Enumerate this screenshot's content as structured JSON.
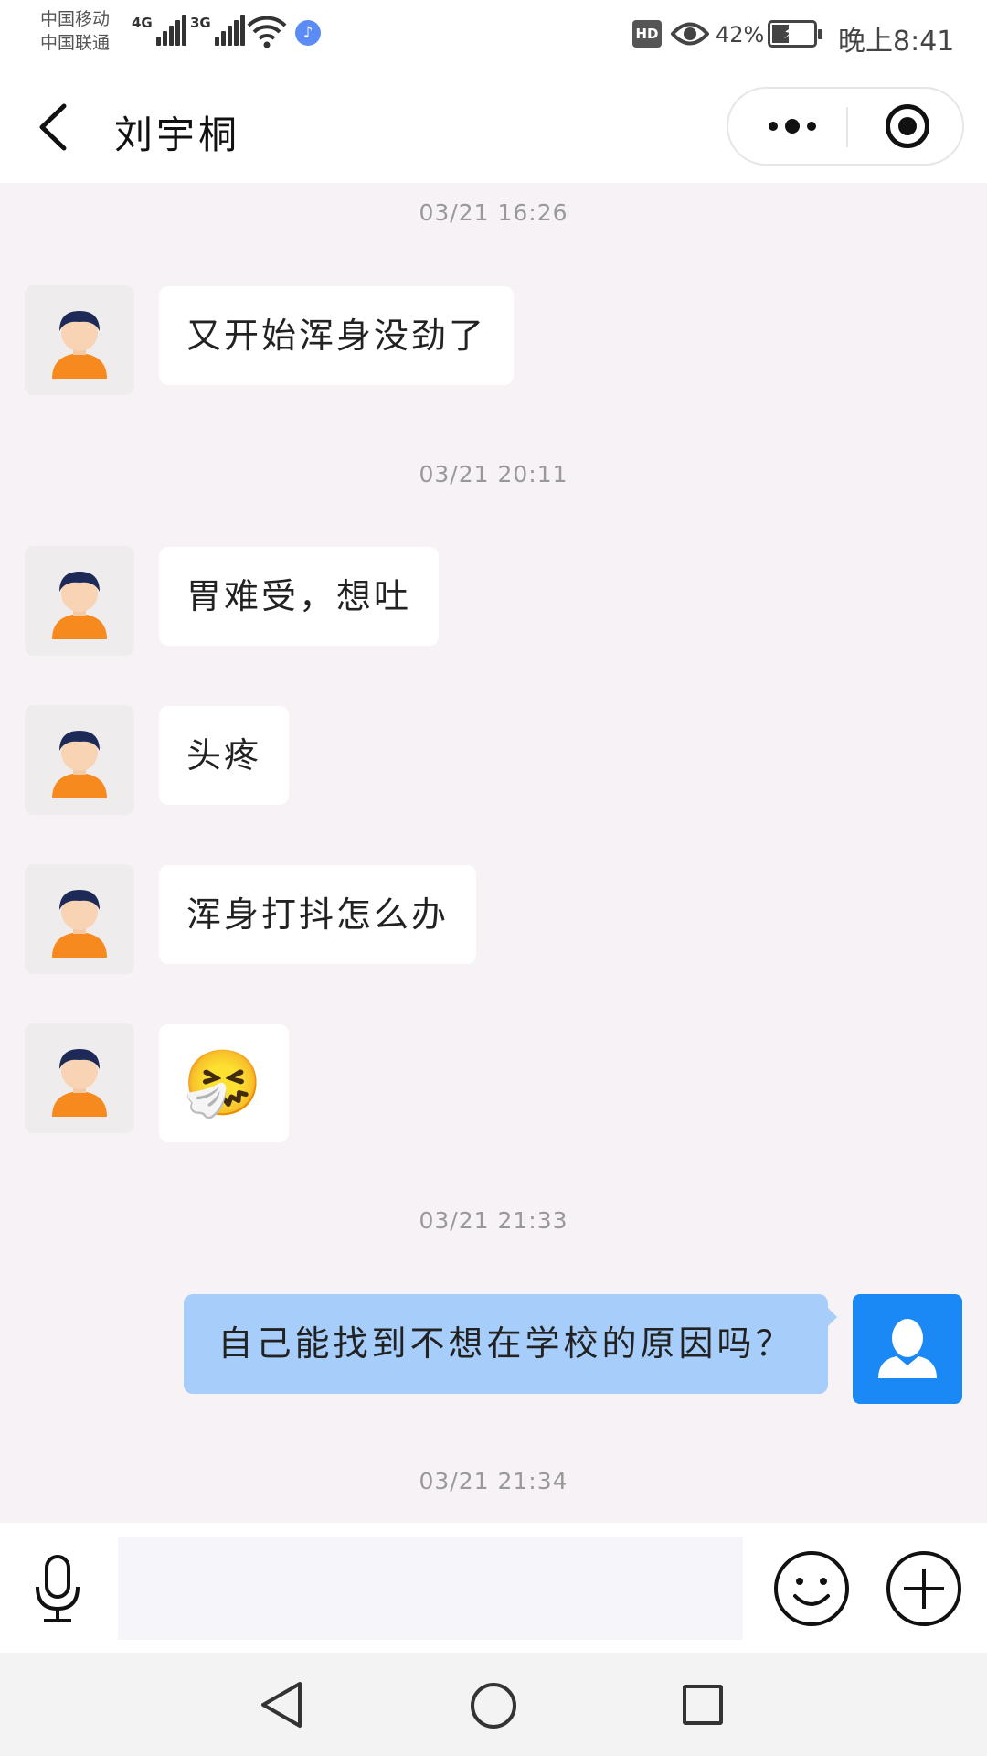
{
  "status_bar": {
    "carrier_1": "中国移动",
    "carrier_2": "中国联通",
    "network_1": "4G",
    "network_2": "3G",
    "hd": "HD",
    "battery_percent": "42%",
    "battery_level": 0.42,
    "time": "晚上8:41",
    "icons": [
      "signal-icon",
      "wifi-icon",
      "music-icon",
      "eye-icon",
      "battery-charging-icon"
    ]
  },
  "header": {
    "title": "刘宇桐",
    "icons": [
      "back-arrow-icon",
      "more-dots-icon",
      "target-icon"
    ]
  },
  "chat": {
    "timestamps": [
      "03/21 16:26",
      "03/21 20:11",
      "03/21 21:33",
      "03/21 21:34"
    ],
    "incoming": [
      {
        "text": "又开始浑身没劲了"
      },
      {
        "text": "胃难受，想吐"
      },
      {
        "text": "头疼"
      },
      {
        "text": "浑身打抖怎么办"
      },
      {
        "text": "🤧"
      }
    ],
    "outgoing": [
      {
        "text": "自己能找到不想在学校的原因吗？"
      }
    ]
  },
  "input_bar": {
    "placeholder": "",
    "icons": [
      "microphone-icon",
      "emoji-icon",
      "plus-icon"
    ]
  },
  "nav_bar": {
    "icons": [
      "nav-back-icon",
      "nav-home-icon",
      "nav-recent-icon"
    ]
  },
  "colors": {
    "chat_background": "#f6f2f5",
    "outgoing_bubble": "#a7cdfa",
    "my_avatar": "#1a88f5",
    "avatar_shirt": "#f68a1e",
    "avatar_hair": "#1d2a57"
  }
}
